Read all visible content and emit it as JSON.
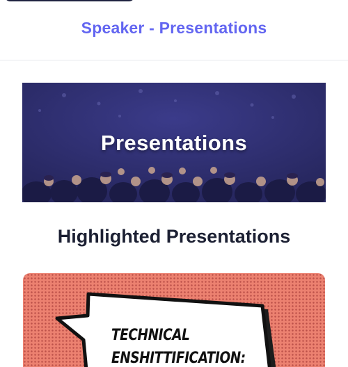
{
  "header": {
    "title": "Speaker - Presentations"
  },
  "hero": {
    "title": "Presentations"
  },
  "section": {
    "heading": "Highlighted Presentations"
  },
  "featured_card": {
    "cover_text_line1": "Technical",
    "cover_text_line2": "Enshittification:"
  },
  "colors": {
    "accent": "#6366f1",
    "heading": "#1c2033",
    "hero_overlay": "#2f2f73",
    "card_background": "#ec8170"
  }
}
